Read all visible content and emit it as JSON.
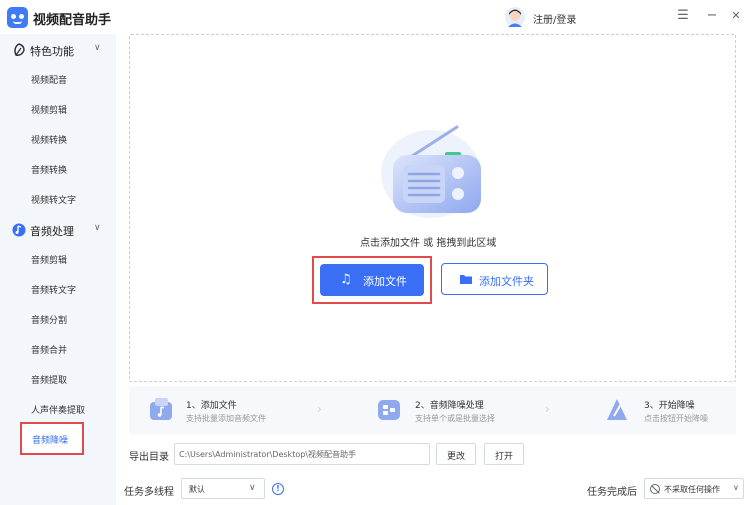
{
  "app": {
    "title": "视频配音助手",
    "login_label": "注册/登录"
  },
  "window": {
    "menu_icon": "☰",
    "minimize_icon": "−",
    "close_icon": "✕"
  },
  "sidebar": {
    "sections": [
      {
        "label": "特色功能",
        "icon": "leaf-icon",
        "chevron": "∨"
      },
      {
        "label": "音频处理",
        "icon": "audio-icon",
        "chevron": "∨"
      }
    ],
    "items": [
      {
        "label": "视频配音"
      },
      {
        "label": "视频剪辑"
      },
      {
        "label": "视频转换"
      },
      {
        "label": "音频转换"
      },
      {
        "label": "视频转文字"
      },
      {
        "label": "音频剪辑"
      },
      {
        "label": "音频转文字"
      },
      {
        "label": "音频分割"
      },
      {
        "label": "音频合并"
      },
      {
        "label": "音频提取"
      },
      {
        "label": "人声伴奏提取"
      },
      {
        "label": "音频降噪",
        "active": true
      }
    ]
  },
  "dropzone": {
    "hint": "点击添加文件 或 拖拽到此区域",
    "add_file_label": "添加文件",
    "add_folder_label": "添加文件夹"
  },
  "steps": [
    {
      "title": "1、添加文件",
      "desc": "支持批量添加音频文件"
    },
    {
      "title": "2、音频降噪处理",
      "desc": "支持单个或是批量选择"
    },
    {
      "title": "3、开始降噪",
      "desc": "点击按钮开始降噪"
    }
  ],
  "step_arrow": "›",
  "output": {
    "label": "导出目录",
    "path": "C:\\Users\\Administrator\\Desktop\\视频配音助手",
    "change_label": "更改",
    "open_label": "打开"
  },
  "task": {
    "thread_label": "任务多线程",
    "thread_value": "默认",
    "info": "!",
    "after_label": "任务完成后",
    "after_value": "不采取任何操作"
  },
  "colors": {
    "accent": "#3a6ff5",
    "highlight": "#e34a4a",
    "sidebar_bg": "#f3f6fb"
  }
}
